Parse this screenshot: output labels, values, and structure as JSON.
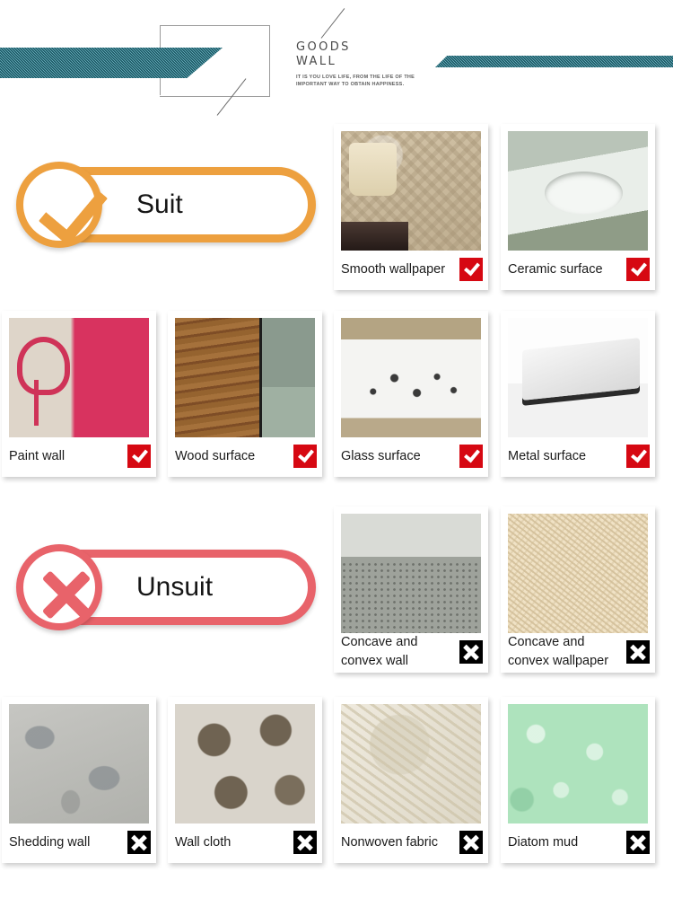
{
  "header": {
    "title_line1": "GOODS",
    "title_line2": "WALL",
    "subtitle": "IT IS YOU LOVE LIFE, FROM THE LIFE OF THE IMPORTANT WAY TO OBTAIN HAPPINESS.",
    "band_color": "#1c7f93"
  },
  "sections": [
    {
      "badge_label": "Suit",
      "badge_color": "#eda03f",
      "badge_icon": "check-circle-icon"
    },
    {
      "badge_label": "Unsuit",
      "badge_color": "#e8636a",
      "badge_icon": "cross-circle-icon"
    }
  ],
  "suit_items": [
    {
      "label": "Smooth wallpaper",
      "mark": "check-mark-icon",
      "mark_color": "#d60812"
    },
    {
      "label": "Ceramic surface",
      "mark": "check-mark-icon",
      "mark_color": "#d60812"
    },
    {
      "label": "Paint wall",
      "mark": "check-mark-icon",
      "mark_color": "#d60812"
    },
    {
      "label": "Wood surface",
      "mark": "check-mark-icon",
      "mark_color": "#d60812"
    },
    {
      "label": "Glass surface",
      "mark": "check-mark-icon",
      "mark_color": "#d60812"
    },
    {
      "label": "Metal surface",
      "mark": "check-mark-icon",
      "mark_color": "#d60812"
    }
  ],
  "unsuit_items": [
    {
      "label": "Concave and convex wall",
      "mark": "x-mark-icon",
      "mark_color": "#000000"
    },
    {
      "label": "Concave and convex wallpaper",
      "mark": "x-mark-icon",
      "mark_color": "#000000"
    },
    {
      "label": "Shedding wall",
      "mark": "x-mark-icon",
      "mark_color": "#000000"
    },
    {
      "label": "Wall cloth",
      "mark": "x-mark-icon",
      "mark_color": "#000000"
    },
    {
      "label": "Nonwoven fabric",
      "mark": "x-mark-icon",
      "mark_color": "#000000"
    },
    {
      "label": "Diatom mud",
      "mark": "x-mark-icon",
      "mark_color": "#000000"
    }
  ]
}
